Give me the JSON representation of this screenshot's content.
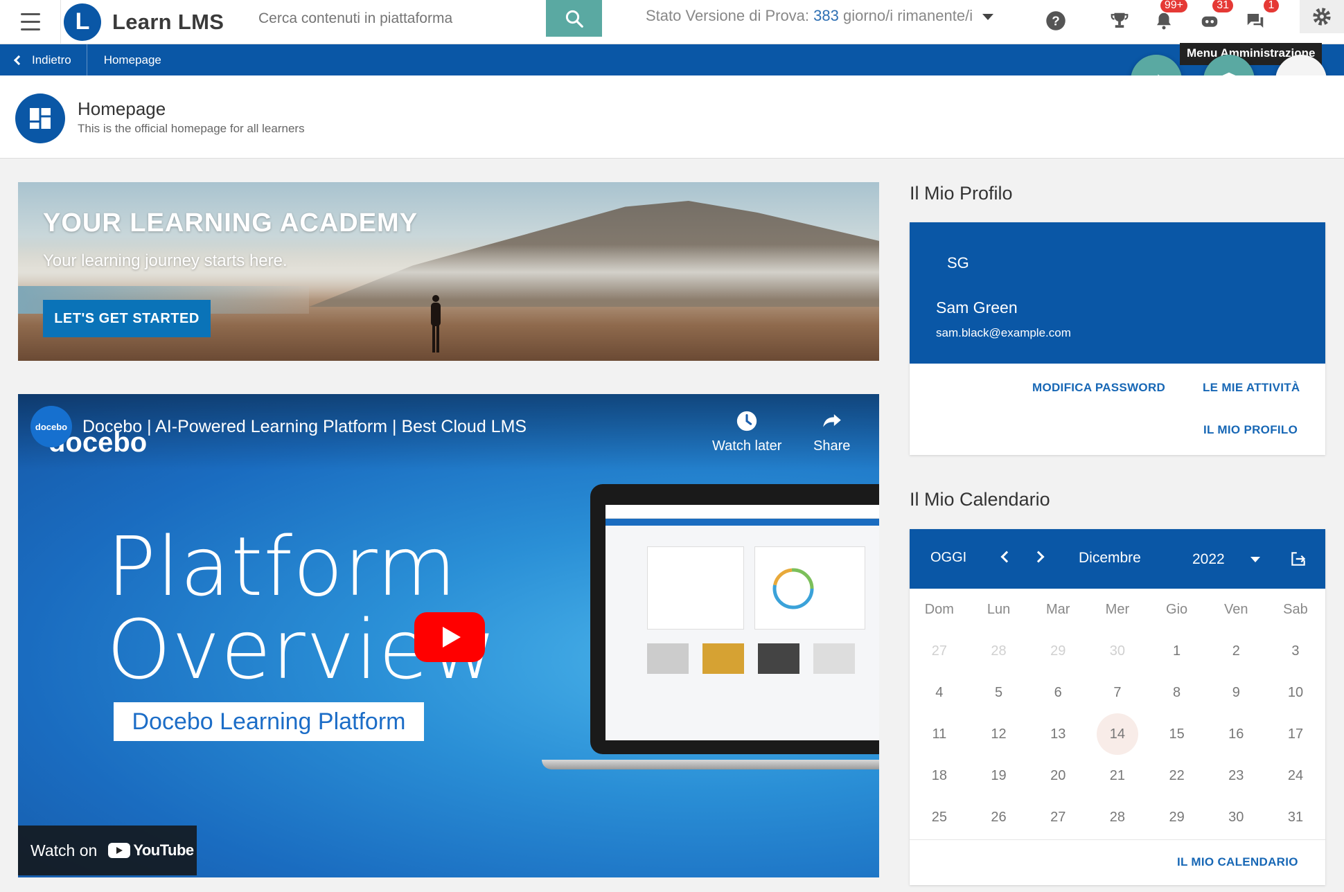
{
  "topbar": {
    "app_name": "Learn LMS",
    "logo_letter": "L",
    "search_placeholder": "Cerca contenuti in piattaforma",
    "trial_label": "Stato Versione di Prova:",
    "trial_days": "383",
    "trial_suffix": "giorno/i rimanente/i",
    "notifications_badge": "99+",
    "messages_badge": "31",
    "chat_badge": "1",
    "admin_tooltip": "Menu Amministrazione"
  },
  "breadcrumb": {
    "back_label": "Indietro",
    "current": "Homepage"
  },
  "page": {
    "title": "Homepage",
    "subtitle": "This is the official homepage for all learners"
  },
  "banner": {
    "title": "YOUR LEARNING ACADEMY",
    "subtitle": "Your learning journey starts here.",
    "button_label": "LET'S GET STARTED"
  },
  "video": {
    "channel_logo_text": "docebo",
    "wordmark": "docebo",
    "title": "Docebo | AI-Powered Learning Platform | Best Cloud LMS",
    "watch_later_label": "Watch later",
    "share_label": "Share",
    "headline_line1": "Platform",
    "headline_line2": "Overview",
    "subheadline": "Docebo Learning Platform",
    "watch_on_label": "Watch on",
    "youtube_label": "YouTube"
  },
  "profile": {
    "section_title": "Il Mio Profilo",
    "initials": "SG",
    "name": "Sam Green",
    "email": "sam.black@example.com",
    "change_password": "MODIFICA PASSWORD",
    "my_activities": "LE MIE ATTIVITÀ",
    "my_profile": "IL MIO PROFILO"
  },
  "calendar": {
    "section_title": "Il Mio Calendario",
    "today_label": "OGGI",
    "month": "Dicembre",
    "year": "2022",
    "weekdays": [
      "Dom",
      "Lun",
      "Mar",
      "Mer",
      "Gio",
      "Ven",
      "Sab"
    ],
    "weeks": [
      [
        "27",
        "28",
        "29",
        "30",
        "1",
        "2",
        "3"
      ],
      [
        "4",
        "5",
        "6",
        "7",
        "8",
        "9",
        "10"
      ],
      [
        "11",
        "12",
        "13",
        "14",
        "15",
        "16",
        "17"
      ],
      [
        "18",
        "19",
        "20",
        "21",
        "22",
        "23",
        "24"
      ],
      [
        "25",
        "26",
        "27",
        "28",
        "29",
        "30",
        "31"
      ]
    ],
    "today_day": "14",
    "footer_link": "IL MIO CALENDARIO"
  },
  "colors": {
    "brand_blue": "#0a57a6",
    "search_teal": "#5aa9a2",
    "badge_red": "#e53935",
    "link_blue": "#1767b5"
  },
  "icons": {
    "menu": "hamburger-icon",
    "search": "search-icon",
    "help": "help-icon",
    "trophy": "trophy-icon",
    "notifications": "bell-icon",
    "messages": "chat-bot-icon",
    "chat": "chat-icon",
    "admin": "gear-icon",
    "share_fab": "share-icon",
    "course_fab": "graduation-cap-icon",
    "link_fab": "link-icon"
  }
}
